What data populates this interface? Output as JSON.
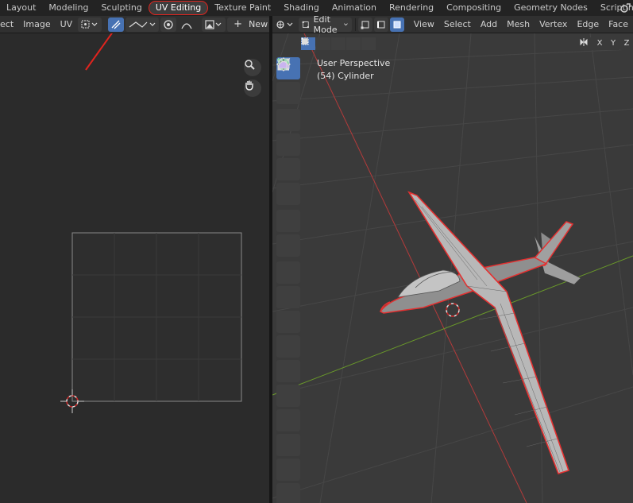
{
  "workspace_tabs": [
    "Layout",
    "Modeling",
    "Sculpting",
    "UV Editing",
    "Texture Paint",
    "Shading",
    "Animation",
    "Rendering",
    "Compositing",
    "Geometry Nodes",
    "Scripting"
  ],
  "active_workspace": "UV Editing",
  "add_workspace": "+",
  "uv_header": {
    "menu_view": "ect",
    "menu_image": "Image",
    "menu_uv": "UV",
    "new_label": "New",
    "new_plus": "+"
  },
  "viewport_header": {
    "mode": "Edit Mode",
    "menus": [
      "View",
      "Select",
      "Add",
      "Mesh",
      "Vertex",
      "Edge",
      "Face"
    ]
  },
  "viewport_overlay": {
    "perspective": "User Perspective",
    "object": "(54) Cylinder",
    "axes": [
      "X",
      "Y",
      "Z"
    ]
  },
  "annotation": {
    "highlight_color": "#e0241e"
  },
  "icons": {
    "toolbar": [
      "select-box-icon",
      "cursor-icon",
      "move-icon",
      "rotate-icon",
      "scale-icon",
      "transform-icon",
      "annotate-icon",
      "measure-icon",
      "add-cube-icon",
      "extrude-icon",
      "inset-icon",
      "bevel-icon",
      "loop-cut-icon",
      "knife-icon",
      "poly-build-icon",
      "spin-icon",
      "smooth-icon",
      "shrink-icon"
    ]
  }
}
